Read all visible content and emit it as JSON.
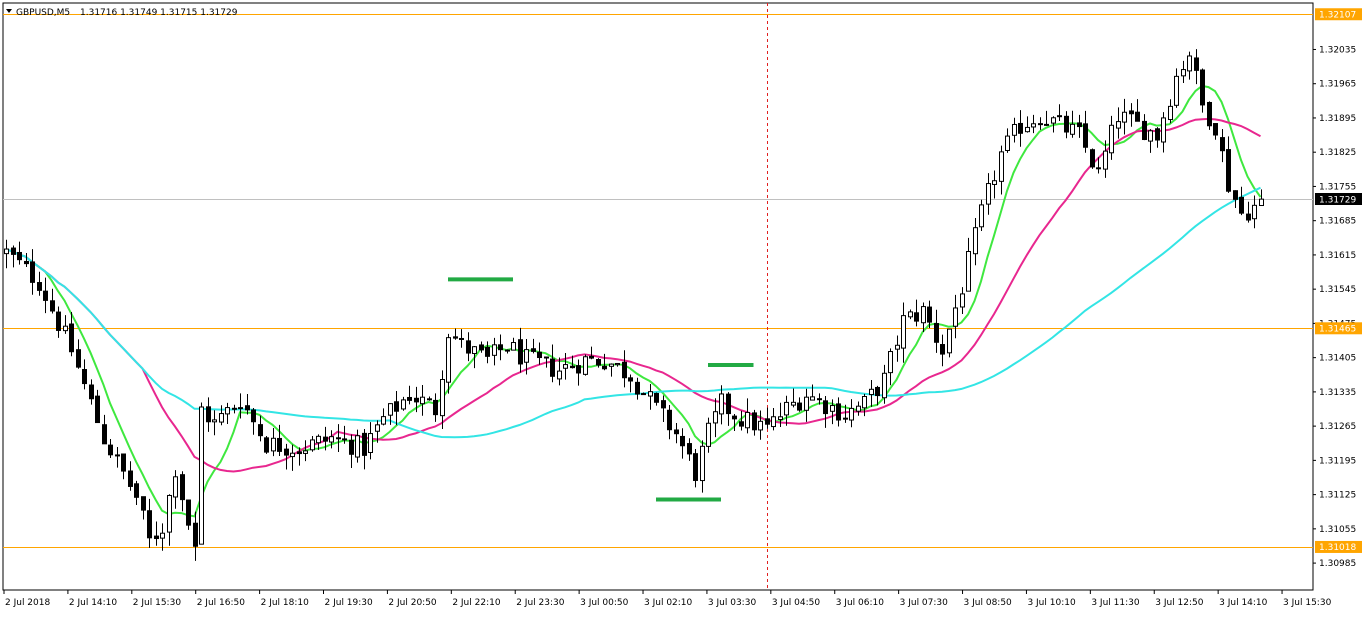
{
  "header": {
    "symbol_label": "GBPUSD,M5",
    "ohlc_label": "1.31716 1.31749 1.31715 1.31729"
  },
  "chart_data": {
    "type": "candlestick",
    "symbol": "GBPUSD",
    "timeframe": "M5",
    "ohlc": {
      "open": 1.31716,
      "high": 1.31749,
      "low": 1.31715,
      "close": 1.31729
    },
    "current_price": "1.31729",
    "ylim": [
      1.3093,
      1.3213
    ],
    "y_ticks": [
      "1.32035",
      "1.31965",
      "1.31895",
      "1.31825",
      "1.31755",
      "1.31685",
      "1.31615",
      "1.31545",
      "1.31475",
      "1.31405",
      "1.31335",
      "1.31265",
      "1.31195",
      "1.31125",
      "1.31055",
      "1.30985"
    ],
    "x_ticks": [
      "2 Jul 2018",
      "2 Jul 14:10",
      "2 Jul 15:30",
      "2 Jul 16:50",
      "2 Jul 18:10",
      "2 Jul 19:30",
      "2 Jul 20:50",
      "2 Jul 22:10",
      "2 Jul 23:30",
      "3 Jul 00:50",
      "3 Jul 02:10",
      "3 Jul 03:30",
      "3 Jul 04:50",
      "3 Jul 06:10",
      "3 Jul 07:30",
      "3 Jul 08:50",
      "3 Jul 10:10",
      "3 Jul 11:30",
      "3 Jul 12:50",
      "3 Jul 14:10",
      "3 Jul 15:30"
    ],
    "horizontal_levels": [
      {
        "label": "1.32107",
        "value": 1.32107,
        "color": "#FFA500"
      },
      {
        "label": "1.31465",
        "value": 1.31465,
        "color": "#FFA500"
      },
      {
        "label": "1.31018",
        "value": 1.31018,
        "color": "#FFA500"
      }
    ],
    "vertical_line_bar": 117,
    "close_path_anchors": [
      [
        0,
        1.3162
      ],
      [
        5,
        1.3156
      ],
      [
        10,
        1.3142
      ],
      [
        15,
        1.3124
      ],
      [
        20,
        1.3112
      ],
      [
        22,
        1.3103
      ],
      [
        24,
        1.3106
      ],
      [
        26,
        1.3118
      ],
      [
        29,
        1.3101
      ],
      [
        30,
        1.313
      ],
      [
        32,
        1.3127
      ],
      [
        36,
        1.3132
      ],
      [
        40,
        1.3123
      ],
      [
        45,
        1.3122
      ],
      [
        50,
        1.3124
      ],
      [
        55,
        1.3122
      ],
      [
        58,
        1.3128
      ],
      [
        62,
        1.3133
      ],
      [
        66,
        1.313
      ],
      [
        68,
        1.3146
      ],
      [
        70,
        1.3143
      ],
      [
        74,
        1.314
      ],
      [
        77,
        1.3143
      ],
      [
        80,
        1.314
      ],
      [
        85,
        1.3138
      ],
      [
        89,
        1.314
      ],
      [
        92,
        1.314
      ],
      [
        96,
        1.3137
      ],
      [
        100,
        1.313
      ],
      [
        103,
        1.3125
      ],
      [
        106,
        1.3117
      ],
      [
        108,
        1.3125
      ],
      [
        110,
        1.3131
      ],
      [
        113,
        1.3128
      ],
      [
        117,
        1.3126
      ],
      [
        120,
        1.313
      ],
      [
        123,
        1.3133
      ],
      [
        126,
        1.3131
      ],
      [
        129,
        1.3129
      ],
      [
        132,
        1.3131
      ],
      [
        135,
        1.3136
      ],
      [
        138,
        1.3148
      ],
      [
        141,
        1.315
      ],
      [
        144,
        1.3142
      ],
      [
        147,
        1.3155
      ],
      [
        150,
        1.317
      ],
      [
        153,
        1.3182
      ],
      [
        156,
        1.3188
      ],
      [
        159,
        1.319
      ],
      [
        162,
        1.3188
      ],
      [
        165,
        1.3186
      ],
      [
        168,
        1.3178
      ],
      [
        171,
        1.319
      ],
      [
        174,
        1.3188
      ],
      [
        177,
        1.3186
      ],
      [
        180,
        1.3198
      ],
      [
        182,
        1.3203
      ],
      [
        184,
        1.3192
      ],
      [
        186,
        1.3188
      ],
      [
        188,
        1.3176
      ],
      [
        190,
        1.317
      ],
      [
        193,
        1.3172
      ]
    ],
    "series": [
      {
        "name": "",
        "kind": "ma",
        "color": "#3FE83F",
        "period": 7
      },
      {
        "name": "",
        "kind": "ma",
        "color": "#E8278F",
        "period": 22
      },
      {
        "name": "",
        "kind": "ma",
        "color": "#33E5E5",
        "period": 60
      }
    ],
    "markers": [
      {
        "label": "",
        "value": 1.31565,
        "from_bar": 68,
        "to_bar": 78,
        "color": "#22AA44"
      },
      {
        "label": "",
        "value": 1.3139,
        "from_bar": 108,
        "to_bar": 115,
        "color": "#22AA44"
      },
      {
        "label": "",
        "value": 1.31115,
        "from_bar": 100,
        "to_bar": 110,
        "color": "#22AA44"
      }
    ],
    "grid": false,
    "legend": "none"
  }
}
